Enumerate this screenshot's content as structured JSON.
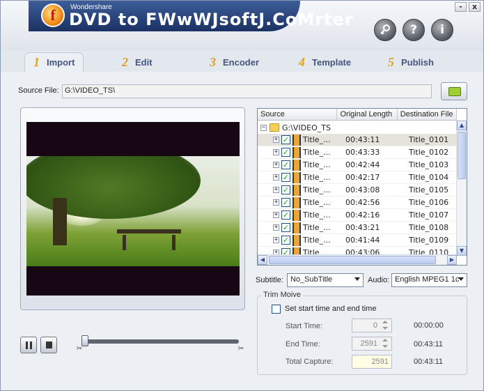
{
  "header": {
    "brand": "Wondershare",
    "title": "DVD to FWwWJsoftJ.CoMrter",
    "window_controls": {
      "minimize": "-",
      "close": "x"
    },
    "buttons": {
      "register": "register-icon",
      "help": "?",
      "info": "i"
    }
  },
  "tabs": [
    {
      "num": "1",
      "label": "Import",
      "active": true
    },
    {
      "num": "2",
      "label": "Edit"
    },
    {
      "num": "3",
      "label": "Encoder"
    },
    {
      "num": "4",
      "label": "Template"
    },
    {
      "num": "5",
      "label": "Publish"
    }
  ],
  "source": {
    "label": "Source File:",
    "value": "G:\\VIDEO_TS\\"
  },
  "tree": {
    "columns": [
      "Source",
      "Original Length",
      "Destination File"
    ],
    "root": "G:\\VIDEO_TS",
    "rows": [
      {
        "name": "Title_...",
        "length": "00:43:11",
        "dest": "Title_0101"
      },
      {
        "name": "Title_...",
        "length": "00:43:33",
        "dest": "Title_0102"
      },
      {
        "name": "Title_...",
        "length": "00:42:44",
        "dest": "Title_0103"
      },
      {
        "name": "Title_...",
        "length": "00:42:17",
        "dest": "Title_0104"
      },
      {
        "name": "Title_...",
        "length": "00:43:08",
        "dest": "Title_0105"
      },
      {
        "name": "Title_...",
        "length": "00:42:56",
        "dest": "Title_0106"
      },
      {
        "name": "Title_...",
        "length": "00:42:16",
        "dest": "Title_0107"
      },
      {
        "name": "Title_...",
        "length": "00:43:21",
        "dest": "Title_0108"
      },
      {
        "name": "Title_...",
        "length": "00:41:44",
        "dest": "Title_0109"
      },
      {
        "name": "Title",
        "length": "00:43:06",
        "dest": "Title_0110"
      }
    ]
  },
  "subtitle": {
    "label": "Subtitle:",
    "value": "No_SubTitle"
  },
  "audio": {
    "label": "Audio:",
    "value": "English MPEG1 1c"
  },
  "trim": {
    "title": "Trim Moive",
    "checkbox_label": "Set start time  and end time",
    "start": {
      "label": "Start Time:",
      "value": "0",
      "time": "00:00:00"
    },
    "end": {
      "label": "End Time:",
      "value": "2591",
      "time": "00:43:11"
    },
    "total": {
      "label": "Total Capture:",
      "value": "2591",
      "time": "00:43:11"
    }
  },
  "playback": {
    "position_fraction": 0.0
  }
}
